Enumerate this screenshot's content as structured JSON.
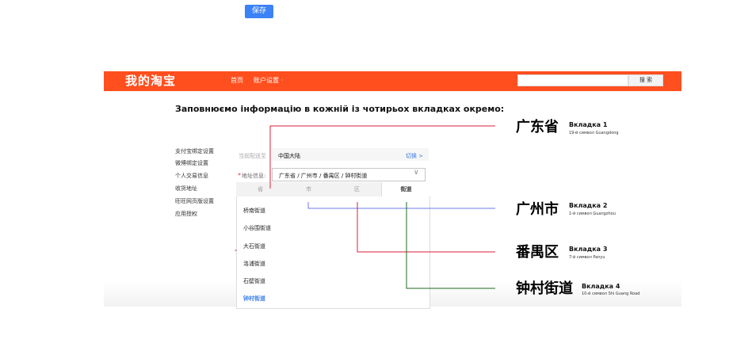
{
  "top_button": {
    "label": "保存"
  },
  "header": {
    "logo": "我的淘宝",
    "nav": {
      "home": "首页",
      "account": "账户设置 ·"
    },
    "search": {
      "placeholder": "",
      "button": "搜 索"
    }
  },
  "instruction": "Заповнюємо інформацію в кожній із чотирьох вкладках окремо:",
  "sidebar": {
    "items": [
      "支付宝绑定设置",
      "微博绑定设置",
      "个人交易信息",
      "收货地址",
      "旺旺网页版设置",
      "应用授权"
    ]
  },
  "form": {
    "current_label": "当前配送至",
    "current_value": "中国大陆",
    "switch_link": "切换 >",
    "address_star": "*",
    "address_label": "地址信息:",
    "address_value": "广东省 / 广州市 / 番禺区 / 钟村街道",
    "chevron": "∨"
  },
  "dropdown": {
    "tabs": [
      "省",
      "市",
      "区",
      "街道"
    ],
    "active_tab": "街道",
    "streets": [
      "桥南街道",
      "小谷围街道",
      "大石街道",
      "洛浦街道",
      "石壁街道",
      "钟村街道"
    ],
    "selected_street": "钟村街道"
  },
  "annotations": [
    {
      "chinese": "广东省",
      "tab": "Вкладка 1",
      "note": "19-й символ Guangdong",
      "color": "#d9213a"
    },
    {
      "chinese": "广州市",
      "tab": "Вкладка 2",
      "note": "1-й символ Guangzhou",
      "color": "#6e79e8"
    },
    {
      "chinese": "番禺区",
      "tab": "Вкладка 3",
      "note": "7-й символ Panyu",
      "color": "#d9213a"
    },
    {
      "chinese": "钟村街道",
      "tab": "Вкладка 4",
      "note": "10-й символ Shi Guang Road",
      "color": "#1e6b1e"
    }
  ],
  "small_star": "*",
  "colors": {
    "header": "#ff4f1f",
    "button": "#3b82f6",
    "link": "#3c7de6"
  }
}
